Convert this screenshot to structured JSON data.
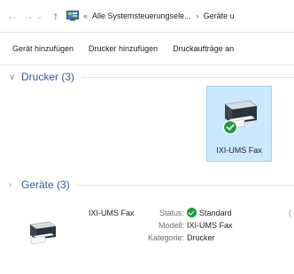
{
  "address_bar": {
    "breadcrumb_overflow": "«",
    "crumbs": [
      "Alle Systemsteuerungsele...",
      "Geräte u"
    ],
    "separator": "›"
  },
  "toolbar": {
    "add_device": "Gerät hinzufügen",
    "add_printer": "Drucker hinzufügen",
    "print_jobs": "Druckaufträge an"
  },
  "groups": {
    "printers": {
      "title": "Drucker (3)",
      "chevron": "∨"
    },
    "devices": {
      "title": "Geräte (3)",
      "chevron": "›"
    }
  },
  "printer_tile": {
    "label": "IXI-UMS Fax"
  },
  "details": {
    "name": "IXI-UMS Fax",
    "status_label": "Status:",
    "status_value": "Standard",
    "model_label": "Modell:",
    "model_value": "IXI-UMS Fax",
    "category_label": "Kategorie:",
    "category_value": "Drucker",
    "truncated_char": "("
  },
  "colors": {
    "selection_bg": "#cce8ff",
    "selection_border": "#99d1ff",
    "group_title": "#2e5d96",
    "status_ok": "#1a9e3a"
  }
}
